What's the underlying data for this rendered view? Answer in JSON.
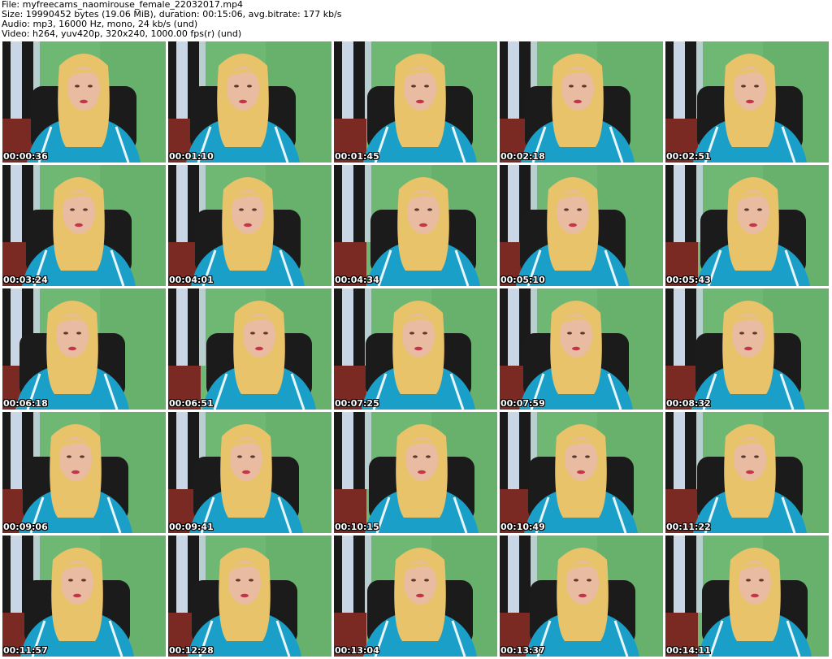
{
  "header": {
    "file_line": "File: myfreecams_naomirouse_female_22032017.mp4",
    "size_line": "Size: 19990452 bytes (19.06 MiB), duration: 00:15:06, avg.bitrate: 177 kb/s",
    "audio_line": "Audio: mp3, 16000 Hz, mono, 24 kb/s (und)",
    "video_line": "Video: h264, yuv420p, 320x240, 1000.00 fps(r) (und)"
  },
  "colors": {
    "wall": "#6fb873",
    "wall_dark": "#5aa35f",
    "curtain_dark": "#1a1a1a",
    "curtain_light": "#c9d6e6",
    "chair": "#1b1b1b",
    "jacket": "#1aa0c8",
    "jacket_stripe": "#e8f6fb",
    "hair": "#e8c36a",
    "skin": "#e9bba0",
    "floor": "#7a2a22"
  },
  "thumbnails": [
    {
      "time": "00:00:36",
      "name": "frame-00-00-36"
    },
    {
      "time": "00:01:10",
      "name": "frame-00-01-10"
    },
    {
      "time": "00:01:45",
      "name": "frame-00-01-45"
    },
    {
      "time": "00:02:18",
      "name": "frame-00-02-18"
    },
    {
      "time": "00:02:51",
      "name": "frame-00-02-51"
    },
    {
      "time": "00:03:24",
      "name": "frame-00-03-24"
    },
    {
      "time": "00:04:01",
      "name": "frame-00-04-01"
    },
    {
      "time": "00:04:34",
      "name": "frame-00-04-34"
    },
    {
      "time": "00:05:10",
      "name": "frame-00-05-10"
    },
    {
      "time": "00:05:43",
      "name": "frame-00-05-43"
    },
    {
      "time": "00:06:18",
      "name": "frame-00-06-18"
    },
    {
      "time": "00:06:51",
      "name": "frame-00-06-51"
    },
    {
      "time": "00:07:25",
      "name": "frame-00-07-25"
    },
    {
      "time": "00:07:59",
      "name": "frame-00-07-59"
    },
    {
      "time": "00:08:32",
      "name": "frame-00-08-32"
    },
    {
      "time": "00:09:06",
      "name": "frame-00-09-06"
    },
    {
      "time": "00:09:41",
      "name": "frame-00-09-41"
    },
    {
      "time": "00:10:15",
      "name": "frame-00-10-15"
    },
    {
      "time": "00:10:49",
      "name": "frame-00-10-49"
    },
    {
      "time": "00:11:22",
      "name": "frame-00-11-22"
    },
    {
      "time": "00:11:57",
      "name": "frame-00-11-57"
    },
    {
      "time": "00:12:28",
      "name": "frame-00-12-28"
    },
    {
      "time": "00:13:04",
      "name": "frame-00-13-04"
    },
    {
      "time": "00:13:37",
      "name": "frame-00-13-37"
    },
    {
      "time": "00:14:11",
      "name": "frame-00-14-11"
    }
  ]
}
